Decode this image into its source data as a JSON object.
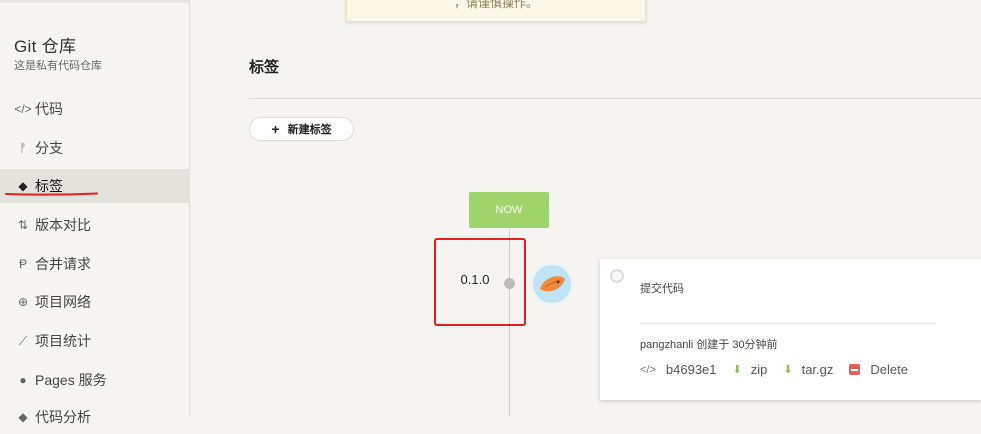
{
  "sidebar": {
    "title": "Git 仓库",
    "subtitle": "这是私有代码仓库",
    "items": [
      {
        "label": "代码",
        "icon": "code-icon",
        "glyph": "</>"
      },
      {
        "label": "分支",
        "icon": "branch-icon",
        "glyph": "ᚠ"
      },
      {
        "label": "标签",
        "icon": "tag-icon",
        "glyph": "◆"
      },
      {
        "label": "版本对比",
        "icon": "compare-icon",
        "glyph": "⇅"
      },
      {
        "label": "合并请求",
        "icon": "merge-request-icon",
        "glyph": "Ᵽ"
      },
      {
        "label": "项目网络",
        "icon": "network-icon",
        "glyph": "⊕"
      },
      {
        "label": "项目统计",
        "icon": "stats-icon",
        "glyph": "⟋"
      },
      {
        "label": "Pages 服务",
        "icon": "pages-icon",
        "glyph": "●"
      },
      {
        "label": "代码分析",
        "icon": "analysis-icon",
        "glyph": "◆"
      }
    ],
    "active_index": 2
  },
  "toast": {
    "text": "，请谨慎操作。"
  },
  "main": {
    "page_title": "标签",
    "new_tag_label": "新建标签",
    "now_label": "NOW",
    "tag_name": "0.1.0"
  },
  "commit_card": {
    "message": "提交代码",
    "meta": "pangzhanli 创建于 30分钟前",
    "hash": "b4693e1",
    "zip_label": "zip",
    "targz_label": "tar.gz",
    "delete_label": "Delete"
  },
  "colors": {
    "now_green": "#9fd46d",
    "annotation_red": "#e02020",
    "download_green": "#8cc152",
    "delete_red": "#e06060"
  }
}
